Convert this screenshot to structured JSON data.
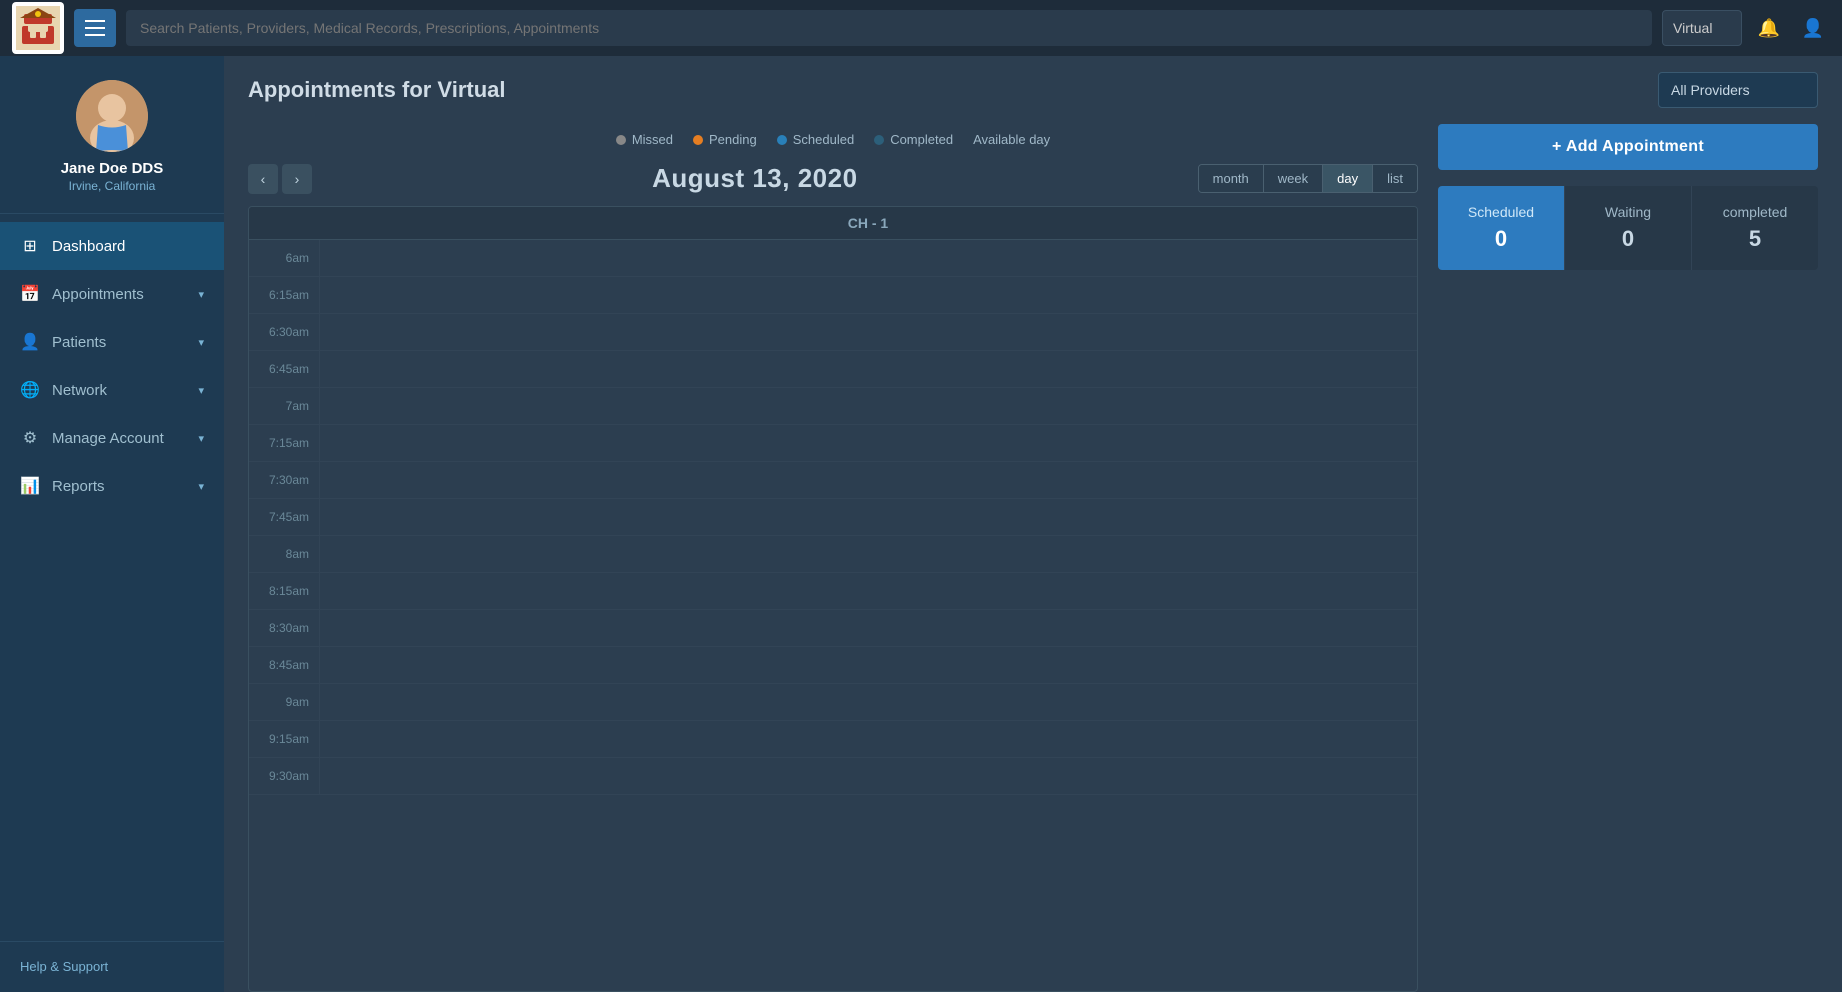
{
  "topNav": {
    "searchPlaceholder": "Search Patients, Providers, Medical Records, Prescriptions, Appointments",
    "locationOptions": [
      "Virtual"
    ],
    "selectedLocation": "Virtual"
  },
  "sidebar": {
    "user": {
      "name": "Jane Doe DDS",
      "location": "Irvine, California"
    },
    "items": [
      {
        "id": "dashboard",
        "label": "Dashboard",
        "icon": "⊞",
        "active": true
      },
      {
        "id": "appointments",
        "label": "Appointments",
        "icon": "📅",
        "active": false,
        "hasChevron": true
      },
      {
        "id": "patients",
        "label": "Patients",
        "icon": "👤",
        "active": false,
        "hasChevron": true
      },
      {
        "id": "network",
        "label": "Network",
        "icon": "🌐",
        "active": false,
        "hasChevron": true
      },
      {
        "id": "manage-account",
        "label": "Manage Account",
        "icon": "⚙",
        "active": false,
        "hasChevron": true
      },
      {
        "id": "reports",
        "label": "Reports",
        "icon": "📊",
        "active": false,
        "hasChevron": true
      }
    ],
    "helpLabel": "Help & Support"
  },
  "pageHeader": {
    "title": "Appointments for Virtual",
    "providerSelectDefault": "All Providers",
    "providerOptions": [
      "All Providers"
    ]
  },
  "legend": {
    "items": [
      {
        "label": "Missed",
        "color": "#888"
      },
      {
        "label": "Pending",
        "color": "#e67e22"
      },
      {
        "label": "Scheduled",
        "color": "#2980b9"
      },
      {
        "label": "Completed",
        "color": "#2c3e50"
      }
    ],
    "availableDayLabel": "Available day"
  },
  "calendar": {
    "currentDate": "August 13, 2020",
    "views": [
      {
        "id": "month",
        "label": "month"
      },
      {
        "id": "week",
        "label": "week"
      },
      {
        "id": "day",
        "label": "day",
        "active": true
      },
      {
        "id": "list",
        "label": "list"
      }
    ],
    "columnHeader": "CH - 1",
    "timeSlots": [
      "6am",
      "6:15am",
      "6:30am",
      "6:45am",
      "7am",
      "7:15am",
      "7:30am",
      "7:45am",
      "8am",
      "8:15am",
      "8:30am",
      "8:45am",
      "9am",
      "9:15am",
      "9:30am"
    ]
  },
  "rightPanel": {
    "addAppointmentLabel": "+ Add Appointment",
    "stats": [
      {
        "id": "scheduled",
        "label": "Scheduled",
        "value": "0",
        "active": true
      },
      {
        "id": "waiting",
        "label": "Waiting",
        "value": "0"
      },
      {
        "id": "completed",
        "label": "completed",
        "value": "5"
      }
    ]
  }
}
